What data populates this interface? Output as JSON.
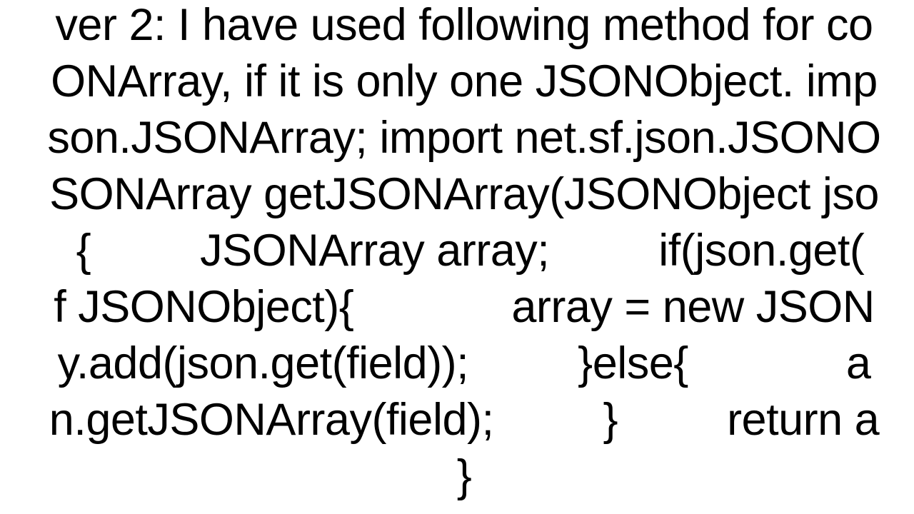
{
  "document": {
    "lines": [
      "ver 2: I have used following method for co",
      "ONArray, if it is only one JSONObject. imp",
      "son.JSONArray; import net.sf.json.JSONO",
      "SONArray getJSONArray(JSONObject jso",
      " {         JSONArray array;         if(json.get(",
      "f JSONObject){             array = new JSON",
      "y.add(json.get(field));         }else{             a",
      "n.getJSONArray(field);         }         return a",
      "}"
    ]
  }
}
